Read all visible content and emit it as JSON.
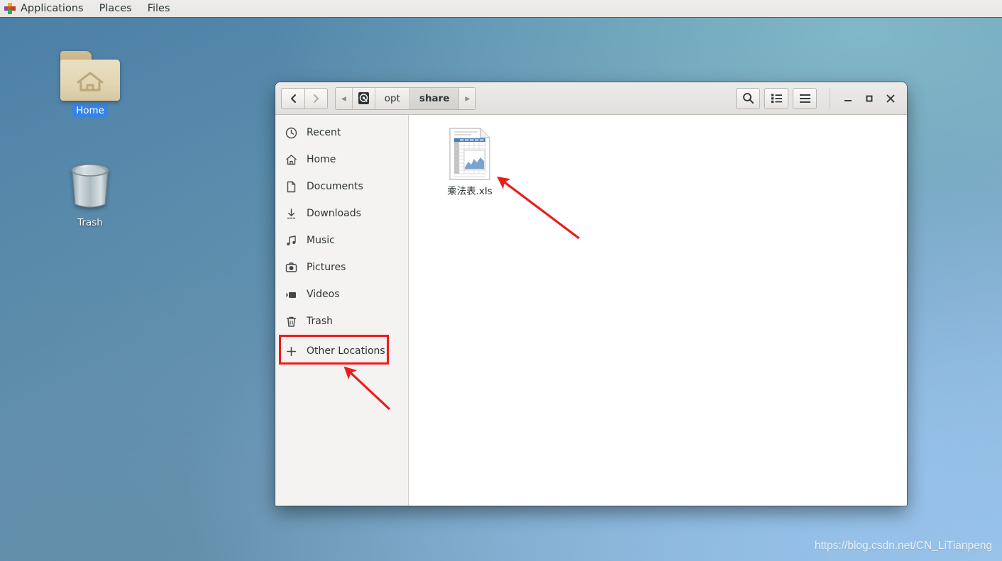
{
  "panel": {
    "apps_icon": "applications-grid-icon",
    "items": [
      {
        "label": "Applications",
        "name": "panel-applications"
      },
      {
        "label": "Places",
        "name": "panel-places"
      },
      {
        "label": "Files",
        "name": "panel-files"
      }
    ]
  },
  "desktop": {
    "icons": [
      {
        "label": "Home",
        "icon": "home-folder-icon",
        "selected": true
      },
      {
        "label": "Trash",
        "icon": "trash-can-icon",
        "selected": false
      }
    ],
    "watermark": "https://blog.csdn.net/CN_LiTianpeng"
  },
  "window": {
    "nav": {
      "back_label": "‹",
      "forward_label": "›"
    },
    "breadcrumb": {
      "left_arrow": "◂",
      "right_arrow": "▸",
      "items": [
        {
          "label": "",
          "icon": "hard-disk-icon",
          "active": false
        },
        {
          "label": "opt",
          "icon": "",
          "active": false
        },
        {
          "label": "share",
          "icon": "",
          "active": true
        }
      ]
    },
    "toolbar": {
      "search_icon": "search-icon",
      "view_toggle_icon": "list-view-icon",
      "menu_icon": "hamburger-menu-icon",
      "minimize_icon": "minimize-icon",
      "maximize_icon": "maximize-icon",
      "close_icon": "close-icon"
    },
    "sidebar": {
      "items": [
        {
          "label": "Recent",
          "icon": "clock-icon"
        },
        {
          "label": "Home",
          "icon": "home-icon"
        },
        {
          "label": "Documents",
          "icon": "document-icon"
        },
        {
          "label": "Downloads",
          "icon": "download-icon"
        },
        {
          "label": "Music",
          "icon": "music-note-icon"
        },
        {
          "label": "Pictures",
          "icon": "camera-icon"
        },
        {
          "label": "Videos",
          "icon": "video-icon"
        },
        {
          "label": "Trash",
          "icon": "trash-icon"
        }
      ],
      "other_locations": {
        "label": "Other Locations",
        "icon": "plus-icon",
        "highlighted": true
      }
    },
    "files": [
      {
        "name": "乘法表.xls",
        "icon": "spreadsheet-file-icon"
      }
    ]
  },
  "annotations": {
    "highlight_color": "#ee1b1b",
    "arrows": [
      {
        "name": "arrow-to-file",
        "points_to": "spreadsheet-file-icon"
      },
      {
        "name": "arrow-to-other-locations",
        "points_to": "other-locations-item"
      }
    ]
  }
}
